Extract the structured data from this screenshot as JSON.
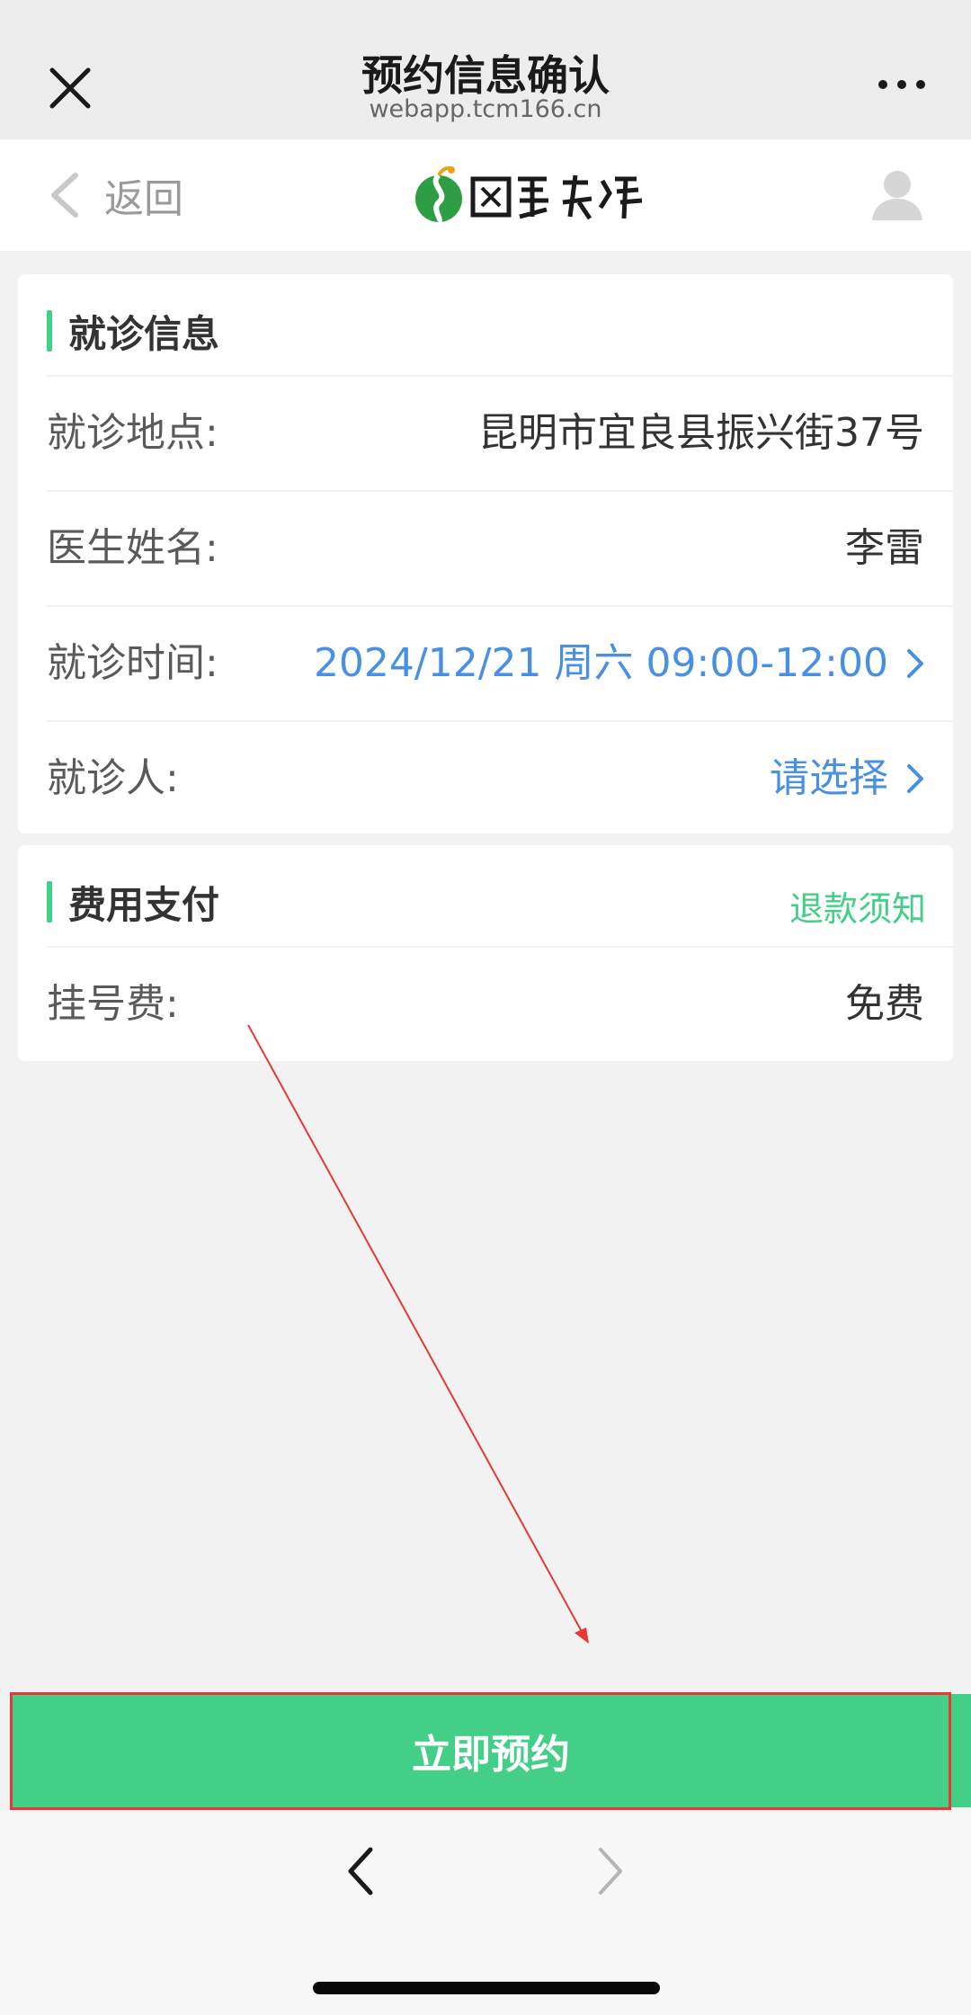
{
  "titlebar": {
    "title": "预约信息确认",
    "url": "webapp.tcm166.cn",
    "close_icon": "close-icon",
    "more_icon": "more-icon"
  },
  "header": {
    "back_label": "返回",
    "logo_text": "國醫在綫",
    "avatar_icon": "user-avatar-icon"
  },
  "visit_info": {
    "section_title": "就诊信息",
    "rows": [
      {
        "label": "就诊地点:",
        "value": "昆明市宜良县振兴街37号"
      },
      {
        "label": "医生姓名:",
        "value": "李雷"
      },
      {
        "label": "就诊时间:",
        "value": "2024/12/21 周六 09:00-12:00"
      },
      {
        "label": "就诊人:",
        "value": "请选择"
      }
    ]
  },
  "payment": {
    "section_title": "费用支付",
    "refund_link": "退款须知",
    "fee_label": "挂号费:",
    "fee_value": "免费"
  },
  "action": {
    "book_label": "立即预约"
  },
  "colors": {
    "accent_green": "#43cf87",
    "link_blue": "#4a90e2",
    "annotation_red": "#e53935"
  }
}
